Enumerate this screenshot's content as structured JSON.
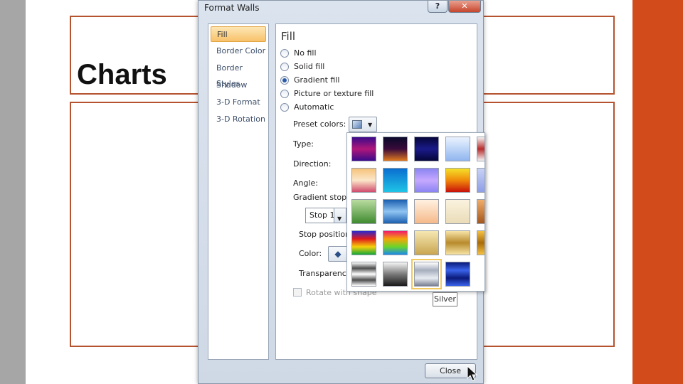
{
  "slide": {
    "title": "Charts"
  },
  "dialog": {
    "title": "Format Walls",
    "help_label": "?",
    "close_glyph": "✕",
    "nav_items": [
      {
        "label": "Fill"
      },
      {
        "label": "Border Color"
      },
      {
        "label": "Border Styles"
      },
      {
        "label": "Shadow"
      },
      {
        "label": "3-D Format"
      },
      {
        "label": "3-D Rotation"
      }
    ],
    "selected_nav": "Fill",
    "section_title": "Fill",
    "fill_options": [
      {
        "label": "No fill",
        "checked": false
      },
      {
        "label": "Solid fill",
        "checked": false
      },
      {
        "label": "Gradient fill",
        "checked": true
      },
      {
        "label": "Picture or texture fill",
        "checked": false
      },
      {
        "label": "Automatic",
        "checked": false
      }
    ],
    "labels": {
      "preset_colors": "Preset colors:",
      "type": "Type:",
      "direction": "Direction:",
      "angle": "Angle:",
      "gradient_stops": "Gradient stops",
      "stop_position": "Stop position:",
      "color": "Color:",
      "transparency": "Transparency",
      "rotate_with_shape": "Rotate with shape"
    },
    "stop_select_value": "Stop 1",
    "color_icon": "paint-bucket-icon",
    "rotate_with_shape_checked": false,
    "close_button": "Close"
  },
  "gallery": {
    "tooltip": "Silver",
    "hovered": "Silver",
    "presets": [
      [
        "linear-gradient(#3a0a8a, #b0177a, #3a0a8a)",
        "linear-gradient(#0a0a2a, #3a0a3a, #e07a20)",
        "linear-gradient(#05053a, #1a1a8a, #05053a)",
        "linear-gradient(#eaf3ff, #8fb5ee)",
        "linear-gradient(#f3f3f3, #b82c2c, #f3f3f3)"
      ],
      [
        "linear-gradient(#f6c27a, #fbe7c9, #d04a6c)",
        "linear-gradient(#0a6ed0, #1fc5e6)",
        "linear-gradient(#8a84f2, #c6a8ff, #8a84f2)",
        "linear-gradient(#f5e12a, #f08a0a, #c8100a)",
        "linear-gradient(#c8d2f6, #8e9ee6)"
      ],
      [
        "linear-gradient(#b9dca0, #3f8a2f)",
        "linear-gradient(#1a5fb0, #8fc4f2, #1a5fb0)",
        "linear-gradient(#fff1e0, #f6b98a)",
        "linear-gradient(#fbf3df, #eadcb8)",
        "linear-gradient(#f2ad6a, #a3561c)"
      ],
      [
        "linear-gradient(#2a2ad0, #e01a1a, #f5d20a, #12a73a)",
        "linear-gradient(#f01a6a, #f5a60a, #6ad42a, #1a8af0)",
        "linear-gradient(#f5e7b2, #c9a550)",
        "linear-gradient(#f7e4a6, #b88a2c, #f7e4a6)",
        "linear-gradient(#f5c142, #a96b0a, #f5c142)"
      ],
      [
        "linear-gradient(#ffffff, #4e4e4e, #ffffff, #4e4e4e, #ffffff)",
        "linear-gradient(#f5f5f5, #7a7a7a, #1a1a1a)",
        "linear-gradient(#ffffff, #a6adbd, #e8ecf2, #7a8092)",
        "linear-gradient(#0a1a7a, #3a63ea, #0a1a7a, #3a63ea)",
        ""
      ]
    ]
  }
}
